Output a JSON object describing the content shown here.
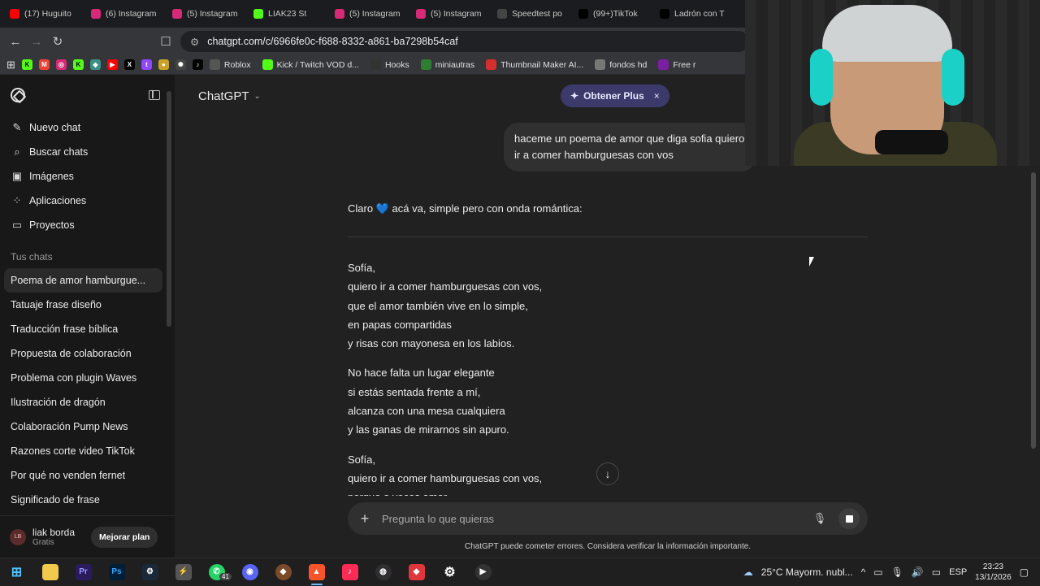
{
  "browser": {
    "tabs": [
      {
        "label": "(17) Huguito",
        "icon": "youtube-icon",
        "color": "#ff0000"
      },
      {
        "label": "(6) Instagram",
        "icon": "instagram-icon",
        "color": "#d62976"
      },
      {
        "label": "(5) Instagram",
        "icon": "instagram-icon",
        "color": "#d62976"
      },
      {
        "label": "LIAK23 St",
        "icon": "kick-icon",
        "color": "#53fc18"
      },
      {
        "label": "(5) Instagram",
        "icon": "instagram-icon",
        "color": "#d62976"
      },
      {
        "label": "(5) Instagram",
        "icon": "instagram-icon",
        "color": "#d62976"
      },
      {
        "label": "Speedtest po",
        "icon": "speedtest-icon",
        "color": "#444444"
      },
      {
        "label": "(99+)TikTok",
        "icon": "tiktok-icon",
        "color": "#000000"
      },
      {
        "label": "Ladrón con T",
        "icon": "tiktok-icon",
        "color": "#000000"
      }
    ],
    "url": "chatgpt.com/c/6966fe0c-f688-8332-a861-ba7298b54caf",
    "bookmarks": [
      {
        "label": "Roblox",
        "icon": "roblox-icon",
        "color": "#555555"
      },
      {
        "label": "Kick / Twitch VOD d...",
        "icon": "kick-icon",
        "color": "#53fc18"
      },
      {
        "label": "Hooks",
        "icon": "hooks-icon",
        "color": "#333333"
      },
      {
        "label": "miniautras",
        "icon": "grid-icon",
        "color": "#2e7d32"
      },
      {
        "label": "Thumbnail Maker AI...",
        "icon": "thumbnail-icon",
        "color": "#d32f2f"
      },
      {
        "label": "fondos hd",
        "icon": "image-icon",
        "color": "#777777"
      },
      {
        "label": "Free r",
        "icon": "free-icon",
        "color": "#7b1fa2"
      }
    ]
  },
  "sidebar": {
    "nav": [
      {
        "label": "Nuevo chat",
        "icon": "✎"
      },
      {
        "label": "Buscar chats",
        "icon": "⌕"
      },
      {
        "label": "Imágenes",
        "icon": "▣"
      },
      {
        "label": "Aplicaciones",
        "icon": "⁘"
      },
      {
        "label": "Proyectos",
        "icon": "▭"
      }
    ],
    "section_label": "Tus chats",
    "chats": [
      "Poema de amor hamburgue...",
      "Tatuaje frase diseño",
      "Traducción frase bíblica",
      "Propuesta de colaboración",
      "Problema con plugin Waves",
      "Ilustración de dragón",
      "Colaboración Pump News",
      "Razones corte video TikTok",
      "Por qué no venden fernet",
      "Significado de frase"
    ],
    "user": {
      "initials": "LB",
      "name": "liak borda",
      "plan": "Gratis",
      "upgrade_label": "Mejorar plan"
    }
  },
  "main": {
    "model_label": "ChatGPT",
    "plus_label": "Obtener Plus",
    "user_message": "haceme un poema de amor que diga sofia quiero ir a comer hamburguesas con vos",
    "assistant_intro_before": "Claro",
    "assistant_intro_after": "acá va, simple pero con onda romántica:",
    "stanzas": [
      [
        "Sofía,",
        "quiero ir a comer hamburguesas con vos,",
        "que el amor también vive en lo simple,",
        "en papas compartidas",
        "y risas con mayonesa en los labios."
      ],
      [
        "No hace falta un lugar elegante",
        "si estás sentada frente a mí,",
        "alcanza con una mesa cualquiera",
        "y las ganas de mirarnos sin apuro."
      ],
      [
        "Sofía,",
        "quiero ir a comer hamburguesas con vos,",
        "porque a veces amar"
      ]
    ],
    "composer_placeholder": "Pregunta lo que quieras",
    "disclaimer": "ChatGPT puede cometer errores. Considera verificar la información importante."
  },
  "taskbar": {
    "weather": "25°C  Mayorm. nubl...",
    "lang": "ESP",
    "time": "23:23",
    "date": "13/1/2026",
    "whatsapp_badge": "41"
  }
}
